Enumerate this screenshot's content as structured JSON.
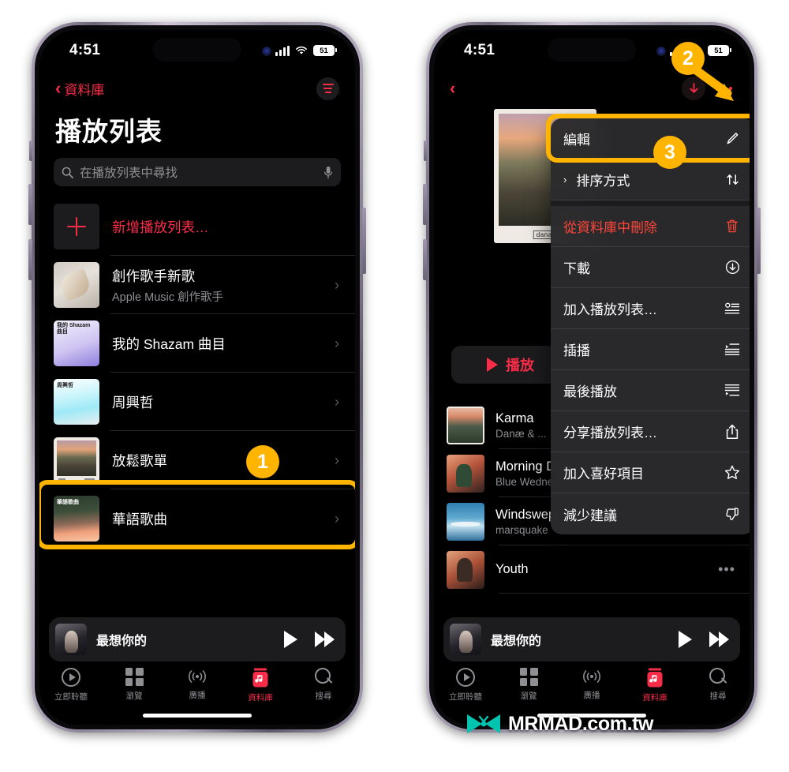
{
  "status_bar": {
    "time": "4:51",
    "battery": "51",
    "signal_icon": "cellular-bars-icon",
    "wifi_icon": "wifi-icon"
  },
  "left_phone": {
    "nav": {
      "back_label": "資料庫",
      "back_icon": "chevron-left-icon",
      "filter_icon": "filter-lines-icon"
    },
    "page_title": "播放列表",
    "search": {
      "placeholder": "在播放列表中尋找",
      "search_icon": "search-icon",
      "mic_icon": "microphone-icon"
    },
    "rows": [
      {
        "title": "新增播放列表…",
        "subtitle": "",
        "art": "plus",
        "chevron": false
      },
      {
        "title": "創作歌手新歌",
        "subtitle": "Apple Music 創作歌手",
        "art": "feather",
        "chevron": true
      },
      {
        "title": "我的 Shazam 曲目",
        "subtitle": "",
        "art": "shazam",
        "art_label": "我的 Shazam 曲目",
        "chevron": true
      },
      {
        "title": "周興哲",
        "subtitle": "",
        "art": "zhou",
        "art_label": "周興哲",
        "chevron": true
      },
      {
        "title": "放鬆歌單",
        "subtitle": "",
        "art": "relax",
        "chevron": true
      },
      {
        "title": "華語歌曲",
        "subtitle": "",
        "art": "hua",
        "art_label": "華語歌曲",
        "chevron": true
      }
    ],
    "mini_player": {
      "title": "最想你的",
      "play_icon": "play-icon",
      "next_icon": "fast-forward-icon"
    },
    "tabs": [
      {
        "label": "立即聆聽",
        "icon": "listen-now-icon",
        "active": false
      },
      {
        "label": "瀏覽",
        "icon": "browse-grid-icon",
        "active": false
      },
      {
        "label": "廣播",
        "icon": "radio-waves-icon",
        "active": false
      },
      {
        "label": "資料庫",
        "icon": "library-icon",
        "active": true
      },
      {
        "label": "搜尋",
        "icon": "search-icon",
        "active": false
      }
    ]
  },
  "right_phone": {
    "nav": {
      "back_icon": "chevron-left-icon",
      "download_icon": "download-arrow-icon",
      "more_icon": "more-dots-icon"
    },
    "album_tag": "danæ",
    "play_button": {
      "label": "播放",
      "icon": "play-icon"
    },
    "context_menu": [
      {
        "label": "編輯",
        "icon": "pencil-icon",
        "danger": false,
        "lead": ""
      },
      {
        "label": "排序方式",
        "icon": "sort-arrows-icon",
        "danger": false,
        "lead": "›"
      },
      {
        "label": "從資料庫中刪除",
        "icon": "trash-icon",
        "danger": true,
        "lead": ""
      },
      {
        "label": "下載",
        "icon": "download-circle-icon",
        "danger": false,
        "lead": ""
      },
      {
        "label": "加入播放列表…",
        "icon": "add-to-playlist-icon",
        "danger": false,
        "lead": ""
      },
      {
        "label": "插播",
        "icon": "play-next-icon",
        "danger": false,
        "lead": ""
      },
      {
        "label": "最後播放",
        "icon": "play-last-icon",
        "danger": false,
        "lead": ""
      },
      {
        "label": "分享播放列表…",
        "icon": "share-icon",
        "danger": false,
        "lead": ""
      },
      {
        "label": "加入喜好項目",
        "icon": "star-icon",
        "danger": false,
        "lead": ""
      },
      {
        "label": "減少建議",
        "icon": "thumbs-down-icon",
        "danger": false,
        "lead": ""
      }
    ],
    "songs": [
      {
        "title": "Karma",
        "subtitle": "Danæ & ...",
        "art": "karma"
      },
      {
        "title": "Morning Dew",
        "subtitle": "Blue Wednesday",
        "art": "morning"
      },
      {
        "title": "Windswept",
        "subtitle": "marsquake",
        "art": "wind"
      },
      {
        "title": "Youth",
        "subtitle": "",
        "art": "youth"
      }
    ],
    "mini_player": {
      "title": "最想你的",
      "play_icon": "play-icon",
      "next_icon": "fast-forward-icon"
    },
    "tabs": [
      {
        "label": "立即聆聽",
        "icon": "listen-now-icon",
        "active": false
      },
      {
        "label": "瀏覽",
        "icon": "browse-grid-icon",
        "active": false
      },
      {
        "label": "廣播",
        "icon": "radio-waves-icon",
        "active": false
      },
      {
        "label": "資料庫",
        "icon": "library-icon",
        "active": true
      },
      {
        "label": "搜尋",
        "icon": "search-icon",
        "active": false
      }
    ]
  },
  "annotations": {
    "step1": "1",
    "step2": "2",
    "step3": "3",
    "highlight_color": "#ffb400"
  },
  "watermark": {
    "text": "MRMAD.com.tw",
    "logo_icon": "mrmad-butterfly-logo"
  },
  "colors": {
    "accent_red": "#fa2d48",
    "danger": "#ff453a",
    "highlight": "#ffb400",
    "bg": "#000000",
    "secondary_text": "#8e8e93"
  }
}
